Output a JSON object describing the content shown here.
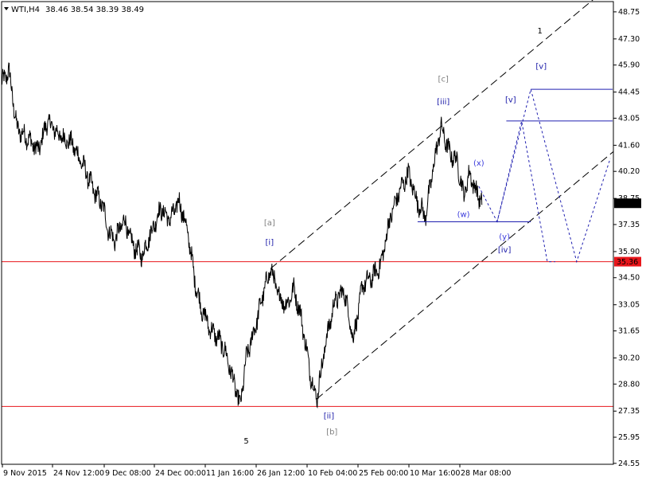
{
  "header": {
    "symbol_timeframe": "WTI,H4",
    "ohlc": "38.46 38.54 38.39 38.49"
  },
  "chart_data": {
    "type": "line",
    "title": "",
    "price_range": [
      24.5,
      49.3
    ],
    "y_ticks": [
      "48.75",
      "47.30",
      "45.90",
      "44.45",
      "43.05",
      "41.60",
      "40.20",
      "38.75",
      "37.35",
      "35.90",
      "34.50",
      "33.05",
      "31.65",
      "30.20",
      "28.80",
      "27.35",
      "25.95",
      "24.55"
    ],
    "x_ticks": [
      "9 Nov 2015",
      "24 Nov 12:00",
      "9 Dec 08:00",
      "24 Dec 00:00",
      "11 Jan 16:00",
      "26 Jan 12:00",
      "10 Feb 04:00",
      "25 Feb 00:00",
      "10 Mar 16:00",
      "28 Mar 08:00"
    ],
    "last_price": "38.49",
    "price_tags": [
      {
        "label": "38.49",
        "value": 38.49,
        "style": "dark"
      },
      {
        "label": "35.36",
        "value": 35.36,
        "style": "red"
      }
    ],
    "horizontal_lines": [
      {
        "value": 35.36,
        "color": "#e8161b"
      },
      {
        "value": 27.6,
        "color": "#e8161b"
      }
    ],
    "price_anchors": [
      {
        "t": 0.0,
        "p": 44.9
      },
      {
        "t": 0.012,
        "p": 45.6
      },
      {
        "t": 0.025,
        "p": 42.5
      },
      {
        "t": 0.045,
        "p": 41.9
      },
      {
        "t": 0.06,
        "p": 41.3
      },
      {
        "t": 0.075,
        "p": 42.9
      },
      {
        "t": 0.095,
        "p": 42.1
      },
      {
        "t": 0.115,
        "p": 41.7
      },
      {
        "t": 0.135,
        "p": 40.4
      },
      {
        "t": 0.15,
        "p": 39.2
      },
      {
        "t": 0.165,
        "p": 38.4
      },
      {
        "t": 0.175,
        "p": 37.0
      },
      {
        "t": 0.185,
        "p": 36.5
      },
      {
        "t": 0.2,
        "p": 37.6
      },
      {
        "t": 0.215,
        "p": 36.2
      },
      {
        "t": 0.23,
        "p": 35.7
      },
      {
        "t": 0.245,
        "p": 37.0
      },
      {
        "t": 0.26,
        "p": 38.2
      },
      {
        "t": 0.275,
        "p": 37.6
      },
      {
        "t": 0.29,
        "p": 38.6
      },
      {
        "t": 0.3,
        "p": 37.5
      },
      {
        "t": 0.308,
        "p": 36.2
      },
      {
        "t": 0.315,
        "p": 34.5
      },
      {
        "t": 0.325,
        "p": 33.0
      },
      {
        "t": 0.34,
        "p": 31.8
      },
      {
        "t": 0.355,
        "p": 31.2
      },
      {
        "t": 0.365,
        "p": 30.6
      },
      {
        "t": 0.378,
        "p": 29.1
      },
      {
        "t": 0.39,
        "p": 27.6
      },
      {
        "t": 0.4,
        "p": 30.2
      },
      {
        "t": 0.415,
        "p": 31.9
      },
      {
        "t": 0.428,
        "p": 33.7
      },
      {
        "t": 0.44,
        "p": 35.0
      },
      {
        "t": 0.452,
        "p": 33.6
      },
      {
        "t": 0.465,
        "p": 33.0
      },
      {
        "t": 0.478,
        "p": 33.9
      },
      {
        "t": 0.49,
        "p": 32.3
      },
      {
        "t": 0.505,
        "p": 29.3
      },
      {
        "t": 0.515,
        "p": 28.0
      },
      {
        "t": 0.53,
        "p": 31.1
      },
      {
        "t": 0.545,
        "p": 33.3
      },
      {
        "t": 0.56,
        "p": 33.8
      },
      {
        "t": 0.575,
        "p": 31.2
      },
      {
        "t": 0.59,
        "p": 34.1
      },
      {
        "t": 0.605,
        "p": 34.5
      },
      {
        "t": 0.62,
        "p": 35.2
      },
      {
        "t": 0.635,
        "p": 37.7
      },
      {
        "t": 0.65,
        "p": 39.1
      },
      {
        "t": 0.665,
        "p": 40.1
      },
      {
        "t": 0.68,
        "p": 38.5
      },
      {
        "t": 0.693,
        "p": 37.8
      },
      {
        "t": 0.705,
        "p": 40.3
      },
      {
        "t": 0.718,
        "p": 42.6
      },
      {
        "t": 0.732,
        "p": 41.2
      },
      {
        "t": 0.745,
        "p": 40.7
      },
      {
        "t": 0.755,
        "p": 38.9
      },
      {
        "t": 0.765,
        "p": 40.1
      },
      {
        "t": 0.775,
        "p": 39.2
      },
      {
        "t": 0.785,
        "p": 38.5
      }
    ],
    "wave_labels": [
      {
        "text": "1",
        "color": "#000000",
        "t": 0.88,
        "p": 47.6,
        "size": 12
      },
      {
        "text": "[c]",
        "color": "#808080",
        "t": 0.722,
        "p": 45.0,
        "size": 10
      },
      {
        "text": "[iii]",
        "color": "#1a1aa8",
        "t": 0.722,
        "p": 43.8,
        "size": 10
      },
      {
        "text": "[v]",
        "color": "#1a1aa8",
        "t": 0.882,
        "p": 45.7,
        "size": 10
      },
      {
        "text": "[v]",
        "color": "#1a1aa8",
        "t": 0.832,
        "p": 43.9,
        "size": 10
      },
      {
        "text": "(x)",
        "color": "#3b3bdc",
        "t": 0.78,
        "p": 40.5,
        "size": 10
      },
      {
        "text": "(w)",
        "color": "#3b3bdc",
        "t": 0.755,
        "p": 37.75,
        "size": 10
      },
      {
        "text": "(y)",
        "color": "#3b3bdc",
        "t": 0.822,
        "p": 36.55,
        "size": 10
      },
      {
        "text": "[iv]",
        "color": "#1a1aa8",
        "t": 0.822,
        "p": 35.85,
        "size": 10
      },
      {
        "text": "[a]",
        "color": "#808080",
        "t": 0.438,
        "p": 37.3,
        "size": 10
      },
      {
        "text": "[i]",
        "color": "#1a1aa8",
        "t": 0.438,
        "p": 36.25,
        "size": 10
      },
      {
        "text": "[ii]",
        "color": "#1a1aa8",
        "t": 0.535,
        "p": 26.95,
        "size": 10
      },
      {
        "text": "[b]",
        "color": "#808080",
        "t": 0.54,
        "p": 26.1,
        "size": 10
      },
      {
        "text": "5",
        "color": "#000000",
        "t": 0.4,
        "p": 25.6,
        "size": 12
      }
    ]
  }
}
